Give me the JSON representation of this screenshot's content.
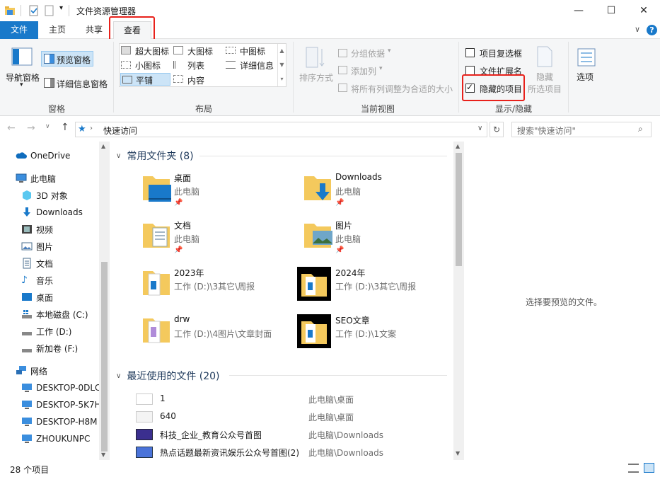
{
  "window": {
    "title": "文件资源管理器",
    "minimize": "—",
    "maximize": "☐",
    "close": "✕",
    "expand": "∨",
    "help": "?"
  },
  "tabs": [
    {
      "label": "文件"
    },
    {
      "label": "主页"
    },
    {
      "label": "共享"
    },
    {
      "label": "查看"
    }
  ],
  "ribbon": {
    "pane": {
      "nav_pane": "导航窗格",
      "preview_pane": "预览窗格",
      "details_pane": "详细信息窗格",
      "group": "窗格"
    },
    "layout": {
      "items": [
        "超大图标",
        "大图标",
        "中图标",
        "小图标",
        "列表",
        "详细信息",
        "平铺",
        "内容"
      ],
      "group": "布局"
    },
    "current_view": {
      "sort_by": "排序方式",
      "group_by": "分组依据",
      "add_column": "添加列",
      "fit_columns": "将所有列调整为合适的大小",
      "group": "当前视图"
    },
    "show_hide": {
      "item_checkboxes": "项目复选框",
      "item_checkboxes_checked": false,
      "file_extensions": "文件扩展名",
      "file_extensions_checked": false,
      "hidden_items": "隐藏的项目",
      "hidden_items_checked": true,
      "hide": "隐藏",
      "selected_items": "所选项目",
      "group": "显示/隐藏"
    },
    "options": "选项"
  },
  "address": {
    "path": "快速访问",
    "search_placeholder": "搜索\"快速访问\""
  },
  "nav": {
    "onedrive": "OneDrive",
    "this_pc": "此电脑",
    "items": [
      "3D 对象",
      "Downloads",
      "视频",
      "图片",
      "文档",
      "音乐",
      "桌面",
      "本地磁盘 (C:)",
      "工作 (D:)",
      "新加卷 (F:)"
    ],
    "network": "网络",
    "network_items": [
      "DESKTOP-0DLC",
      "DESKTOP-5K7H",
      "DESKTOP-H8M",
      "ZHOUKUNPC"
    ]
  },
  "frequent": {
    "header": "常用文件夹 (8)",
    "tiles": [
      {
        "name": "桌面",
        "path": "此电脑"
      },
      {
        "name": "Downloads",
        "path": "此电脑"
      },
      {
        "name": "文档",
        "path": "此电脑"
      },
      {
        "name": "图片",
        "path": "此电脑"
      },
      {
        "name": "2023年",
        "path": "工作 (D:)\\3其它\\周报"
      },
      {
        "name": "2024年",
        "path": "工作 (D:)\\3其它\\周报"
      },
      {
        "name": "drw",
        "path": "工作 (D:)\\4图片\\文章封面"
      },
      {
        "name": "SEO文章",
        "path": "工作 (D:)\\1文案"
      }
    ]
  },
  "recent": {
    "header": "最近使用的文件 (20)",
    "items": [
      {
        "name": "1",
        "path": "此电脑\\桌面"
      },
      {
        "name": "640",
        "path": "此电脑\\桌面"
      },
      {
        "name": "科技_企业_教育公众号首图",
        "path": "此电脑\\Downloads"
      },
      {
        "name": "热点话题最新资讯娱乐公众号首图(2)",
        "path": "此电脑\\Downloads"
      }
    ]
  },
  "preview": {
    "message": "选择要预览的文件。"
  },
  "status": {
    "count": "28 个项目"
  },
  "colors": {
    "accent": "#1979ca",
    "highlight": "#e8211b",
    "folder": "#f4c95d"
  }
}
